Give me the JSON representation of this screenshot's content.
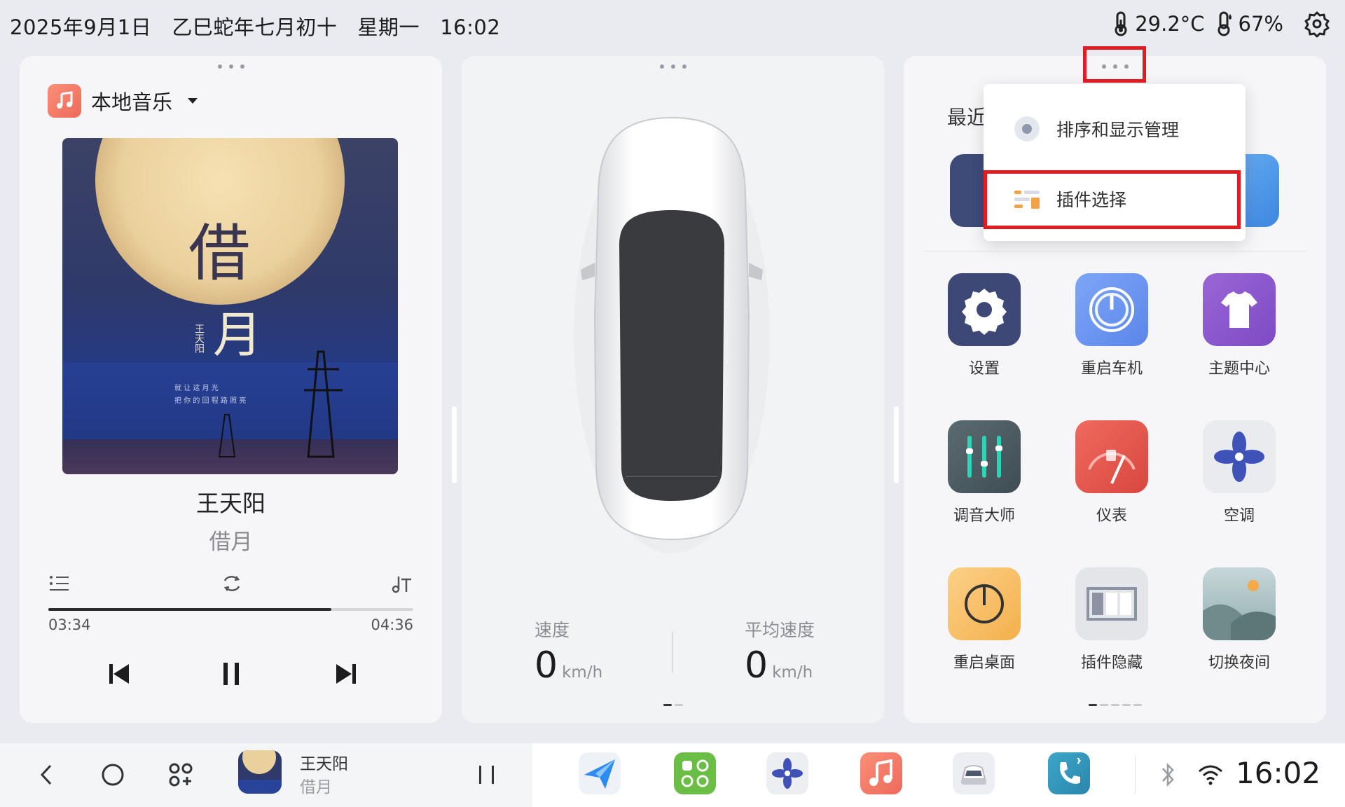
{
  "statusbar": {
    "date": "2025年9月1日",
    "lunar": "乙巳蛇年七月初十",
    "weekday": "星期一",
    "time": "16:02",
    "temperature": "29.2°C",
    "humidity": "67%"
  },
  "music": {
    "source": "本地音乐",
    "artist": "王天阳",
    "title": "借月",
    "elapsed": "03:34",
    "duration": "04:36",
    "progress_fraction": 0.775,
    "album_text": {
      "big1": "借",
      "big2": "月",
      "small_artist": "王天阳",
      "line1": "就 让 这 月 光",
      "line2": "把 你 的 回 程 路 照 亮"
    }
  },
  "vehicle": {
    "speed_label": "速度",
    "speed_value": "0",
    "speed_unit": "km/h",
    "avg_label": "平均速度",
    "avg_value": "0",
    "avg_unit": "km/h"
  },
  "apps": {
    "recent_title": "最近使用",
    "grid": [
      {
        "label": "设置",
        "icon": "gear-icon"
      },
      {
        "label": "重启车机",
        "icon": "power-icon"
      },
      {
        "label": "主题中心",
        "icon": "tshirt-icon"
      },
      {
        "label": "调音大师",
        "icon": "equalizer-icon"
      },
      {
        "label": "仪表",
        "icon": "gauge-icon"
      },
      {
        "label": "空调",
        "icon": "fan-icon"
      },
      {
        "label": "重启桌面",
        "icon": "power-icon"
      },
      {
        "label": "插件隐藏",
        "icon": "columns-icon"
      },
      {
        "label": "切换夜间",
        "icon": "landscape-icon"
      }
    ]
  },
  "popup": {
    "items": [
      {
        "label": "排序和显示管理",
        "icon": "sort-display-icon"
      },
      {
        "label": "插件选择",
        "icon": "plugin-select-icon"
      }
    ]
  },
  "taskbar": {
    "now_playing_artist": "王天阳",
    "now_playing_title": "借月",
    "time": "16:02",
    "dock": [
      "navigation-icon",
      "apps-grid-icon",
      "fan-icon",
      "music-icon",
      "car-icon",
      "phone-icon"
    ]
  },
  "colors": {
    "highlight_box": "#e01c22",
    "music_accent": "#ee6a5c"
  }
}
